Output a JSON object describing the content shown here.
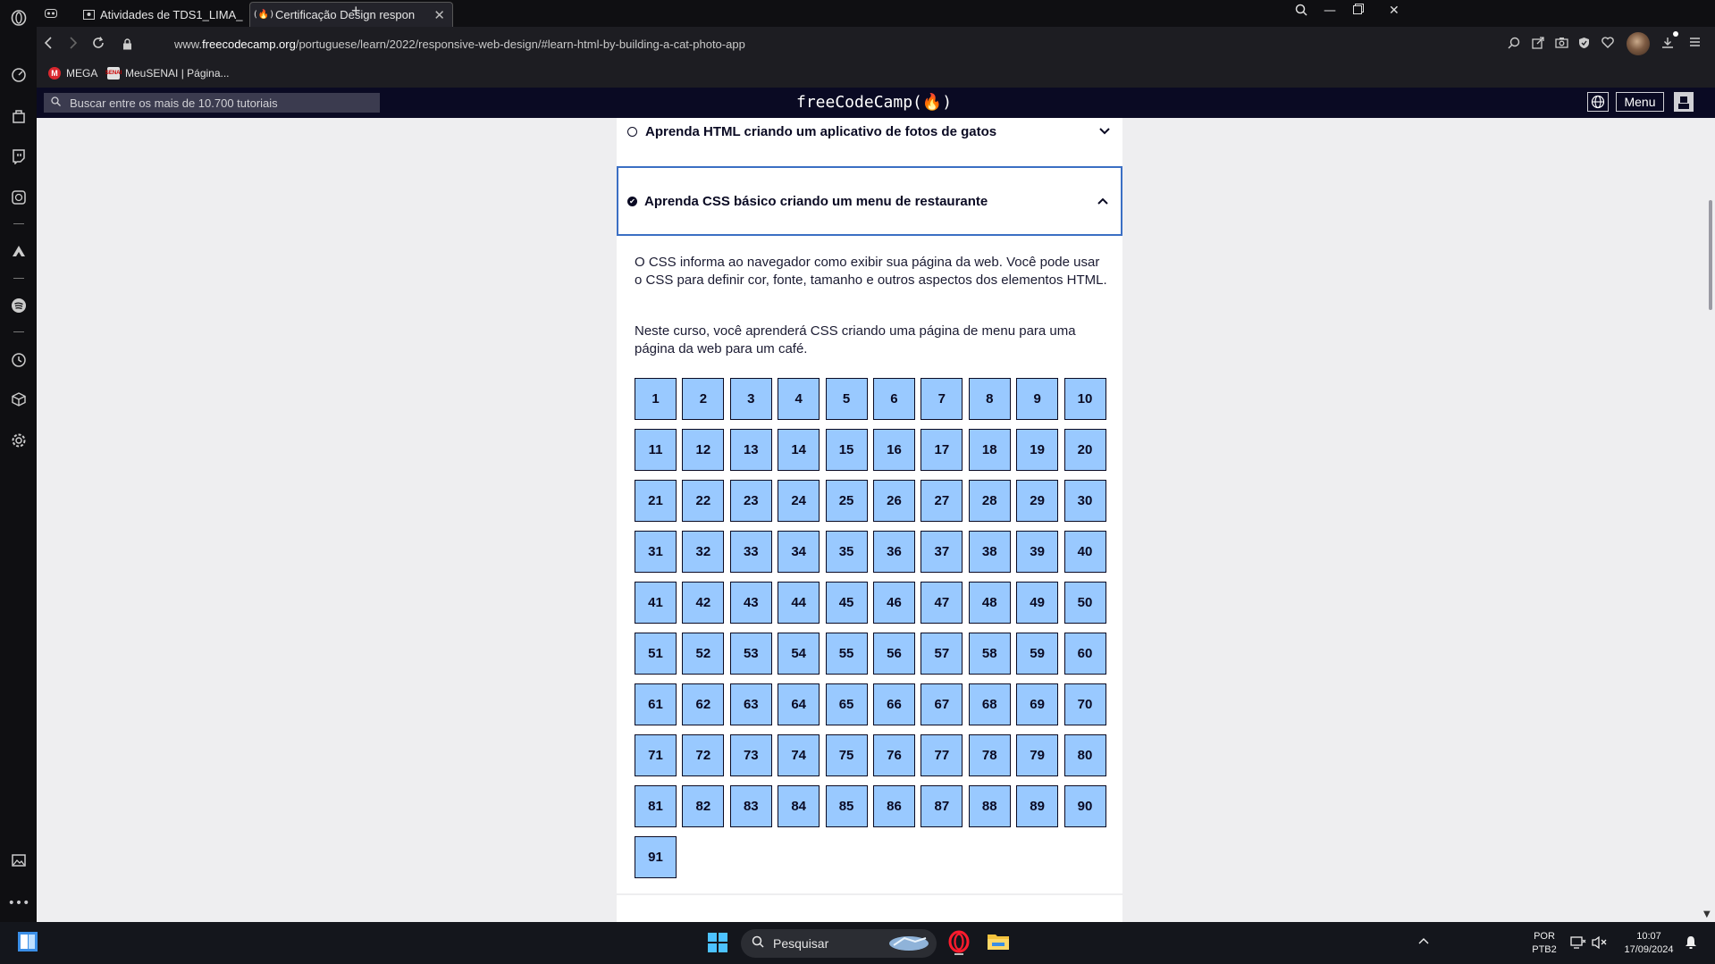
{
  "browser": {
    "tabs": [
      {
        "label": "Atividades de TDS1_LIMA_",
        "close": "✕",
        "active": false
      },
      {
        "label": "Certificação Design respon",
        "close": "✕",
        "active": true
      }
    ],
    "new_tab": "+",
    "url": {
      "prefix": "www.",
      "domain": "freecodecamp.org",
      "path": "/portuguese/learn/2022/responsive-web-design/#learn-html-by-building-a-cat-photo-app"
    },
    "bookmarks": [
      {
        "label": "MEGA",
        "icon": "mega-icon",
        "color": "#d9272e"
      },
      {
        "label": "MeuSENAI | Página...",
        "icon": "senai-icon",
        "color": "#e0e0e0"
      }
    ]
  },
  "fcc": {
    "search_placeholder": "Buscar entre os mais de 10.700 tutoriais",
    "logo": "freeCodeCamp(🔥)",
    "menu_label": "Menu",
    "nav_bg": "#0a0a23"
  },
  "blocks": [
    {
      "title": "Aprenda HTML criando um aplicativo de fotos de gatos",
      "expanded": false,
      "completed": false
    },
    {
      "title": "Aprenda CSS básico criando um menu de restaurante",
      "expanded": true,
      "completed": true
    }
  ],
  "description": [
    "O CSS informa ao navegador como exibir sua página da web. Você pode usar o CSS para definir cor, fonte, tamanho e outros aspectos dos elementos HTML.",
    "Neste curso, você aprenderá CSS criando uma página de menu para uma página da web para um café."
  ],
  "steps": [
    "1",
    "2",
    "3",
    "4",
    "5",
    "6",
    "7",
    "8",
    "9",
    "10",
    "11",
    "12",
    "13",
    "14",
    "15",
    "16",
    "17",
    "18",
    "19",
    "20",
    "21",
    "22",
    "23",
    "24",
    "25",
    "26",
    "27",
    "28",
    "29",
    "30",
    "31",
    "32",
    "33",
    "34",
    "35",
    "36",
    "37",
    "38",
    "39",
    "40",
    "41",
    "42",
    "43",
    "44",
    "45",
    "46",
    "47",
    "48",
    "49",
    "50",
    "51",
    "52",
    "53",
    "54",
    "55",
    "56",
    "57",
    "58",
    "59",
    "60",
    "61",
    "62",
    "63",
    "64",
    "65",
    "66",
    "67",
    "68",
    "69",
    "70",
    "71",
    "72",
    "73",
    "74",
    "75",
    "76",
    "77",
    "78",
    "79",
    "80",
    "81",
    "82",
    "83",
    "84",
    "85",
    "86",
    "87",
    "88",
    "89",
    "90",
    "91"
  ],
  "step_color": "#99c9ff",
  "taskbar": {
    "search_placeholder": "Pesquisar",
    "lang_top": "POR",
    "lang_bottom": "PTB2",
    "time": "10:07",
    "date": "17/09/2024"
  }
}
